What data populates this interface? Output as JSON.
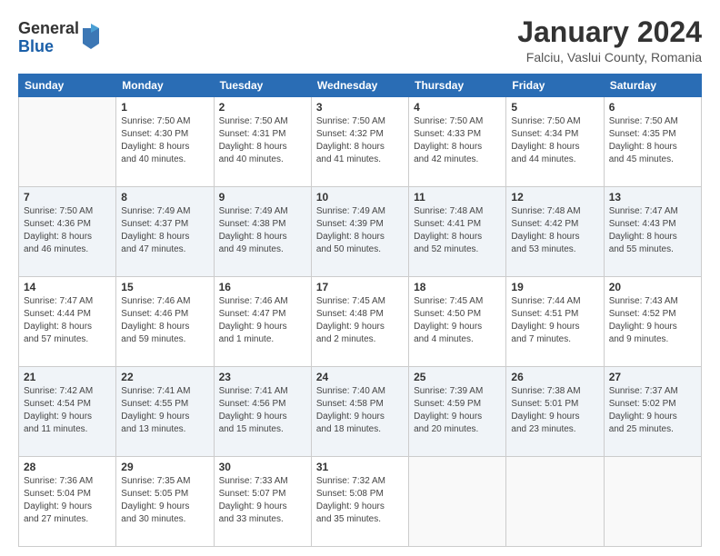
{
  "logo": {
    "general": "General",
    "blue": "Blue"
  },
  "title": "January 2024",
  "subtitle": "Falciu, Vaslui County, Romania",
  "header_days": [
    "Sunday",
    "Monday",
    "Tuesday",
    "Wednesday",
    "Thursday",
    "Friday",
    "Saturday"
  ],
  "weeks": [
    {
      "shade": "white",
      "days": [
        {
          "num": "",
          "info": ""
        },
        {
          "num": "1",
          "info": "Sunrise: 7:50 AM\nSunset: 4:30 PM\nDaylight: 8 hours\nand 40 minutes."
        },
        {
          "num": "2",
          "info": "Sunrise: 7:50 AM\nSunset: 4:31 PM\nDaylight: 8 hours\nand 40 minutes."
        },
        {
          "num": "3",
          "info": "Sunrise: 7:50 AM\nSunset: 4:32 PM\nDaylight: 8 hours\nand 41 minutes."
        },
        {
          "num": "4",
          "info": "Sunrise: 7:50 AM\nSunset: 4:33 PM\nDaylight: 8 hours\nand 42 minutes."
        },
        {
          "num": "5",
          "info": "Sunrise: 7:50 AM\nSunset: 4:34 PM\nDaylight: 8 hours\nand 44 minutes."
        },
        {
          "num": "6",
          "info": "Sunrise: 7:50 AM\nSunset: 4:35 PM\nDaylight: 8 hours\nand 45 minutes."
        }
      ]
    },
    {
      "shade": "shade",
      "days": [
        {
          "num": "7",
          "info": "Sunrise: 7:50 AM\nSunset: 4:36 PM\nDaylight: 8 hours\nand 46 minutes."
        },
        {
          "num": "8",
          "info": "Sunrise: 7:49 AM\nSunset: 4:37 PM\nDaylight: 8 hours\nand 47 minutes."
        },
        {
          "num": "9",
          "info": "Sunrise: 7:49 AM\nSunset: 4:38 PM\nDaylight: 8 hours\nand 49 minutes."
        },
        {
          "num": "10",
          "info": "Sunrise: 7:49 AM\nSunset: 4:39 PM\nDaylight: 8 hours\nand 50 minutes."
        },
        {
          "num": "11",
          "info": "Sunrise: 7:48 AM\nSunset: 4:41 PM\nDaylight: 8 hours\nand 52 minutes."
        },
        {
          "num": "12",
          "info": "Sunrise: 7:48 AM\nSunset: 4:42 PM\nDaylight: 8 hours\nand 53 minutes."
        },
        {
          "num": "13",
          "info": "Sunrise: 7:47 AM\nSunset: 4:43 PM\nDaylight: 8 hours\nand 55 minutes."
        }
      ]
    },
    {
      "shade": "white",
      "days": [
        {
          "num": "14",
          "info": "Sunrise: 7:47 AM\nSunset: 4:44 PM\nDaylight: 8 hours\nand 57 minutes."
        },
        {
          "num": "15",
          "info": "Sunrise: 7:46 AM\nSunset: 4:46 PM\nDaylight: 8 hours\nand 59 minutes."
        },
        {
          "num": "16",
          "info": "Sunrise: 7:46 AM\nSunset: 4:47 PM\nDaylight: 9 hours\nand 1 minute."
        },
        {
          "num": "17",
          "info": "Sunrise: 7:45 AM\nSunset: 4:48 PM\nDaylight: 9 hours\nand 2 minutes."
        },
        {
          "num": "18",
          "info": "Sunrise: 7:45 AM\nSunset: 4:50 PM\nDaylight: 9 hours\nand 4 minutes."
        },
        {
          "num": "19",
          "info": "Sunrise: 7:44 AM\nSunset: 4:51 PM\nDaylight: 9 hours\nand 7 minutes."
        },
        {
          "num": "20",
          "info": "Sunrise: 7:43 AM\nSunset: 4:52 PM\nDaylight: 9 hours\nand 9 minutes."
        }
      ]
    },
    {
      "shade": "shade",
      "days": [
        {
          "num": "21",
          "info": "Sunrise: 7:42 AM\nSunset: 4:54 PM\nDaylight: 9 hours\nand 11 minutes."
        },
        {
          "num": "22",
          "info": "Sunrise: 7:41 AM\nSunset: 4:55 PM\nDaylight: 9 hours\nand 13 minutes."
        },
        {
          "num": "23",
          "info": "Sunrise: 7:41 AM\nSunset: 4:56 PM\nDaylight: 9 hours\nand 15 minutes."
        },
        {
          "num": "24",
          "info": "Sunrise: 7:40 AM\nSunset: 4:58 PM\nDaylight: 9 hours\nand 18 minutes."
        },
        {
          "num": "25",
          "info": "Sunrise: 7:39 AM\nSunset: 4:59 PM\nDaylight: 9 hours\nand 20 minutes."
        },
        {
          "num": "26",
          "info": "Sunrise: 7:38 AM\nSunset: 5:01 PM\nDaylight: 9 hours\nand 23 minutes."
        },
        {
          "num": "27",
          "info": "Sunrise: 7:37 AM\nSunset: 5:02 PM\nDaylight: 9 hours\nand 25 minutes."
        }
      ]
    },
    {
      "shade": "white",
      "days": [
        {
          "num": "28",
          "info": "Sunrise: 7:36 AM\nSunset: 5:04 PM\nDaylight: 9 hours\nand 27 minutes."
        },
        {
          "num": "29",
          "info": "Sunrise: 7:35 AM\nSunset: 5:05 PM\nDaylight: 9 hours\nand 30 minutes."
        },
        {
          "num": "30",
          "info": "Sunrise: 7:33 AM\nSunset: 5:07 PM\nDaylight: 9 hours\nand 33 minutes."
        },
        {
          "num": "31",
          "info": "Sunrise: 7:32 AM\nSunset: 5:08 PM\nDaylight: 9 hours\nand 35 minutes."
        },
        {
          "num": "",
          "info": ""
        },
        {
          "num": "",
          "info": ""
        },
        {
          "num": "",
          "info": ""
        }
      ]
    }
  ]
}
